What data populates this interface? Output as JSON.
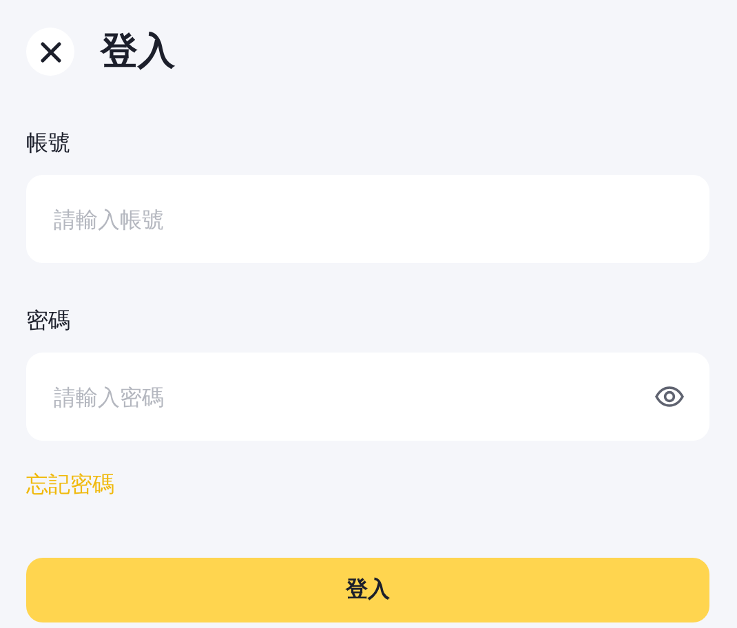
{
  "header": {
    "title": "登入"
  },
  "fields": [
    {
      "label": "帳號",
      "placeholder": "請輸入帳號",
      "kind": "text"
    },
    {
      "label": "密碼",
      "placeholder": "請輸入密碼",
      "kind": "password"
    }
  ],
  "forgot_link": "忘記密碼",
  "submit_button": "登入"
}
